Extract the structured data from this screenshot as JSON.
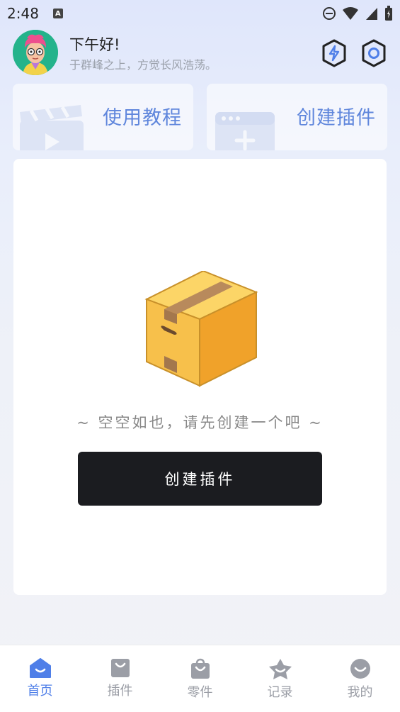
{
  "status_bar": {
    "time": "2:48",
    "notification_letter": "A"
  },
  "header": {
    "greeting": "下午好!",
    "subtitle": "于群峰之上，方觉长风浩荡。"
  },
  "quick_actions": [
    {
      "label": "使用教程",
      "icon": "clapperboard-icon"
    },
    {
      "label": "创建插件",
      "icon": "add-window-icon"
    }
  ],
  "empty_state": {
    "message": "~ 空空如也，请先创建一个吧 ~",
    "button_label": "创建插件"
  },
  "tabs": [
    {
      "label": "首页",
      "icon": "home-icon",
      "active": true
    },
    {
      "label": "插件",
      "icon": "bag-icon",
      "active": false
    },
    {
      "label": "零件",
      "icon": "shopping-bag-icon",
      "active": false
    },
    {
      "label": "记录",
      "icon": "star-icon",
      "active": false
    },
    {
      "label": "我的",
      "icon": "smile-icon",
      "active": false
    }
  ],
  "colors": {
    "accent": "#4f7fe8",
    "quick_label": "#5f86dc",
    "button_bg": "#1b1c20",
    "tab_inactive": "#9b9ea6"
  }
}
